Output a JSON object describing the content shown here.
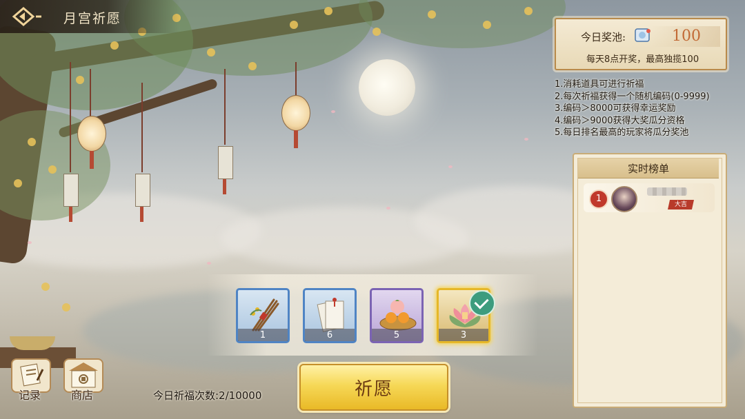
{
  "header": {
    "title": "月宫祈愿"
  },
  "pool": {
    "label": "今日奖池:",
    "value": "100",
    "subtitle": "每天8点开奖，最高独揽100"
  },
  "rules": [
    "1.消耗道具可进行祈福",
    "2.每次祈福获得一个随机编码(0-9999)",
    "3.编码＞8000可获得幸运奖励",
    "4.编码＞9000获得大奖瓜分资格",
    "5.每日排名最高的玩家将瓜分奖池"
  ],
  "leaderboard": {
    "title": "实时榜单",
    "entries": [
      {
        "rank": "1",
        "tag": "大吉"
      }
    ]
  },
  "items": [
    {
      "name": "incense",
      "count": "1",
      "selected": false,
      "frame": "blue"
    },
    {
      "name": "paper",
      "count": "6",
      "selected": false,
      "frame": "blue"
    },
    {
      "name": "fruit-basket",
      "count": "5",
      "selected": false,
      "frame": "purple"
    },
    {
      "name": "lotus-lamp",
      "count": "3",
      "selected": true,
      "frame": "gold"
    }
  ],
  "actions": {
    "pray": "祈愿",
    "records": "记录",
    "shop": "商店"
  },
  "status": {
    "pray_count": "今日祈福次数:2/10000"
  },
  "colors": {
    "accent_gold": "#f6d857",
    "rank_red": "#c0392b",
    "select_green": "#3d9c7e"
  }
}
